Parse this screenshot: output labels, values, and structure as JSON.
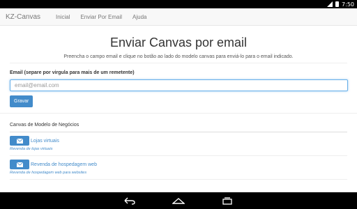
{
  "status": {
    "time": "7:50"
  },
  "navbar": {
    "brand": "KZ-Canvas",
    "items": [
      "Inicial",
      "Enviar Por Email",
      "Ajuda"
    ]
  },
  "hero": {
    "title": "Enviar Canvas por email",
    "subtitle": "Preencha o campo email e clique no botão ao lado do modelo canvas para enviá-lo para o email indicado."
  },
  "form": {
    "label": "Email (separe por virgula para mais de um remetente)",
    "placeholder": "email@email.com",
    "save_label": "Gravar"
  },
  "models": {
    "title": "Canvas de Modelo de Negócios",
    "items": [
      {
        "name": "Lojas virtuais",
        "description": "Revenda de lojas virtuais"
      },
      {
        "name": "Revenda de hospedagem web",
        "description": "Revenda de hospedagem web para websites"
      }
    ]
  },
  "colors": {
    "accent": "#428bca",
    "navbar_bg": "#f8f8f8",
    "system_bar": "#000000"
  },
  "icons": [
    "signal-icon",
    "battery-icon",
    "envelope-icon",
    "back-icon",
    "home-icon",
    "recent-apps-icon"
  ]
}
